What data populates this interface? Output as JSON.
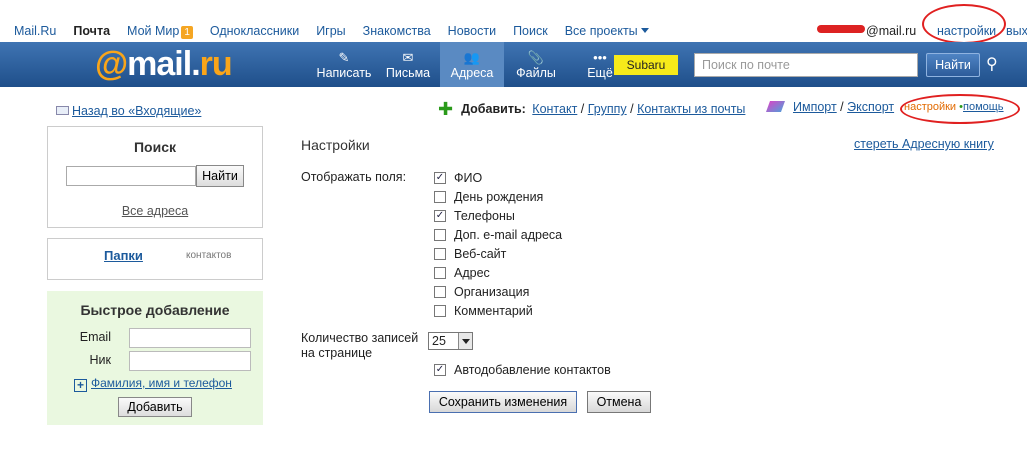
{
  "topnav": {
    "items": [
      {
        "label": "Mail.Ru"
      },
      {
        "label": "Почта"
      },
      {
        "label": "Мой Мир",
        "badge": "1"
      },
      {
        "label": "Одноклассники"
      },
      {
        "label": "Игры"
      },
      {
        "label": "Знакомства"
      },
      {
        "label": "Новости"
      },
      {
        "label": "Поиск"
      },
      {
        "label": "Все проекты"
      }
    ],
    "user_email": "@mail.ru",
    "settings": "настройки",
    "exit": "вых"
  },
  "header": {
    "logo_at": "@",
    "logo_mail": "mail",
    "logo_dot": ".",
    "logo_ru": "ru",
    "tools": [
      {
        "label": "Написать",
        "icon": "pencil-icon",
        "glyph": "✎"
      },
      {
        "label": "Письма",
        "icon": "envelope-icon",
        "glyph": "✉"
      },
      {
        "label": "Адреса",
        "icon": "contacts-icon",
        "glyph": "👥"
      },
      {
        "label": "Файлы",
        "icon": "paperclip-icon",
        "glyph": "📎"
      },
      {
        "label": "Ещё",
        "icon": "more-icon",
        "glyph": "•••"
      }
    ],
    "promo": "Subaru",
    "search_placeholder": "Поиск по почте",
    "search_button": "Найти",
    "colors": {
      "header_top": "#3f74b3",
      "header_bottom": "#1f4f8a",
      "logo_accent": "#f9a51a",
      "promo_bg": "#f6ea1a"
    }
  },
  "sidebar": {
    "back_link": "Назад во «Входящие»",
    "search": {
      "title": "Поиск",
      "button": "Найти",
      "all_link": "Все адреса"
    },
    "folders": {
      "tab_active": "Папки",
      "tab_other": "контактов"
    },
    "quick_add": {
      "title": "Быстрое добавление",
      "email_label": "Email",
      "nick_label": "Ник",
      "more_link": "Фамилия, имя и телефон",
      "button": "Добавить"
    }
  },
  "actions": {
    "add_label": "Добавить:",
    "add_links": [
      "Контакт",
      "Группу",
      "Контакты из почты"
    ],
    "import": "Импорт",
    "export": "Экспорт",
    "settings": "настройки",
    "help": "помощь"
  },
  "settings": {
    "title": "Настройки",
    "clear_link": "стереть Адресную книгу",
    "fields_label": "Отображать поля:",
    "fields": [
      {
        "label": "ФИО",
        "checked": true
      },
      {
        "label": "День рождения",
        "checked": false
      },
      {
        "label": "Телефоны",
        "checked": true
      },
      {
        "label": "Доп. e-mail адреса",
        "checked": false
      },
      {
        "label": "Веб-сайт",
        "checked": false
      },
      {
        "label": "Адрес",
        "checked": false
      },
      {
        "label": "Организация",
        "checked": false
      },
      {
        "label": "Комментарий",
        "checked": false
      }
    ],
    "count_label": "Количество записей на странице",
    "count_value": "25",
    "autoadd_label": "Автодобавление контактов",
    "autoadd_checked": true,
    "save_button": "Сохранить изменения",
    "cancel_button": "Отмена"
  }
}
